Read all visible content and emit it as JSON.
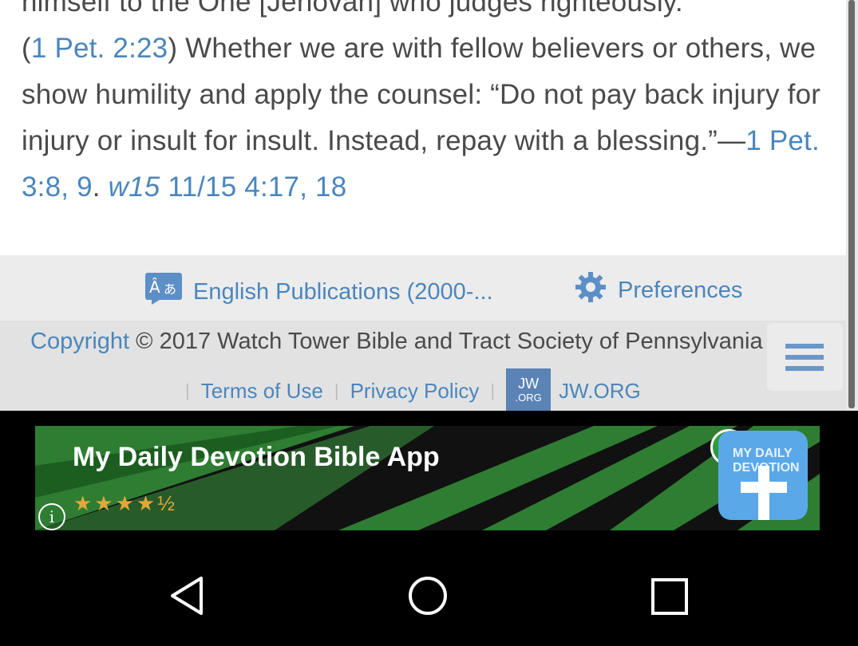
{
  "article": {
    "line1": "himself to the One [Jehovah] who judges righteously.",
    "ref1": "1 Pet. 2:23",
    "text1": ") Whether we are with fellow believers or others, we show humility and apply the counsel: “Do not pay back injury for injury or insult for insult. Instead, repay with a blessing.”—",
    "open_paren": "(",
    "ref2": "1 Pet. 3:8, 9",
    "dot": ". ",
    "ref3_italic": "w15",
    "ref3": " 11/15 4:17, 18"
  },
  "language_bar": {
    "language_label": "English Publications (2000-...",
    "language_icon": "translate-icon",
    "preferences_label": "Preferences",
    "preferences_icon": "gear-icon"
  },
  "footer": {
    "copyright_link": "Copyright",
    "copyright_text": " © 2017 Watch Tower Bible and Tract Society of Pennsylvania",
    "terms": "Terms of Use",
    "privacy": "Privacy Policy",
    "logo_top": "JW",
    "logo_bottom": ".ORG",
    "site": "JW.ORG",
    "separator": "|"
  },
  "menu": {
    "icon": "hamburger-icon"
  },
  "ad": {
    "title": "My Daily Devotion Bible App",
    "stars": "★★★★½",
    "rating": 4.5,
    "info_icon": "info-icon",
    "info_glyph": "i",
    "app_icon_text": "MY DAILY DEVOTION",
    "colors": {
      "green": "#2e7d32",
      "dark": "#111111",
      "icon_blue": "#5ba8e8"
    }
  },
  "navbar": {
    "back_icon": "back-triangle-icon",
    "home_icon": "home-circle-icon",
    "recents_icon": "recents-square-icon"
  },
  "colors": {
    "link": "#4a86bd",
    "text": "#4a4a4a",
    "lang_bar": "#ececec",
    "footer": "#e2e2e2"
  }
}
